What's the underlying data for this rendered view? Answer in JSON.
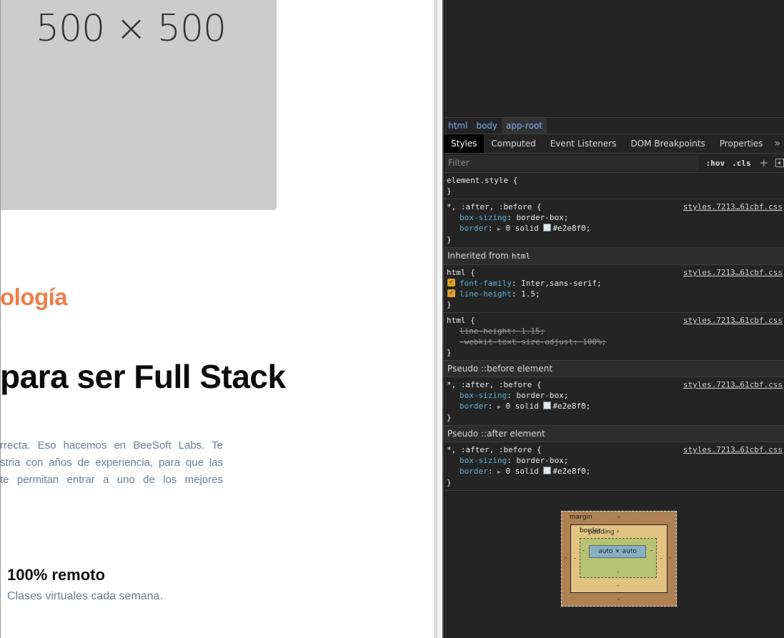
{
  "page": {
    "placeholder_label": "500 × 500",
    "eyebrow": "ología",
    "headline": "para ser Full Stack",
    "paragraph": [
      "rrecta. Eso hacemos en BeeSoft Labs. Te",
      "stria con años de experiencia, para que las",
      "te permitan entrar a uno de los mejores"
    ],
    "feature": {
      "title": "100% remoto",
      "subtitle": "Clases virtuales cada semana."
    }
  },
  "devtools": {
    "breadcrumbs": [
      "html",
      "body",
      "app-root"
    ],
    "tabs": [
      "Styles",
      "Computed",
      "Event Listeners",
      "DOM Breakpoints",
      "Properties"
    ],
    "more_tabs": "»",
    "filter_placeholder": "Filter",
    "hov": ":hov",
    "cls": ".cls",
    "plus": "+",
    "element_style": {
      "selector": "element.style {",
      "close": "}"
    },
    "rules": {
      "universal": {
        "selector": "*, :after, :before {",
        "source": "styles.7213…61cbf.css",
        "box_sizing_prop": "box-sizing",
        "box_sizing_val": "border-box;",
        "border_prop": "border",
        "border_val_pre": "0 solid ",
        "border_val_color": "#e2e8f0;",
        "close": "}"
      },
      "inherited_header": "Inherited from",
      "inherited_tag": "html",
      "html1": {
        "selector": "html {",
        "source": "styles.7213…61cbf.css",
        "font_family_prop": "font-family",
        "font_family_val": "Inter,sans-serif;",
        "line_height_prop": "line-height",
        "line_height_val": "1.5;",
        "close": "}"
      },
      "html2": {
        "selector": "html {",
        "source": "styles.7213…61cbf.css",
        "line_height_prop": "line-height",
        "line_height_val": "1.15;",
        "text_size_prop": "-webkit-text-size-adjust",
        "text_size_val": "100%;",
        "close": "}"
      },
      "before_header": "Pseudo ::before element",
      "after_header": "Pseudo ::after element"
    },
    "box_model": {
      "margin": "margin",
      "border": "border",
      "padding": "padding",
      "content": "auto × auto",
      "dash": "-"
    }
  },
  "colors": {
    "accent_orange": "#f07d4a",
    "swatch": "#e2e8f0"
  }
}
